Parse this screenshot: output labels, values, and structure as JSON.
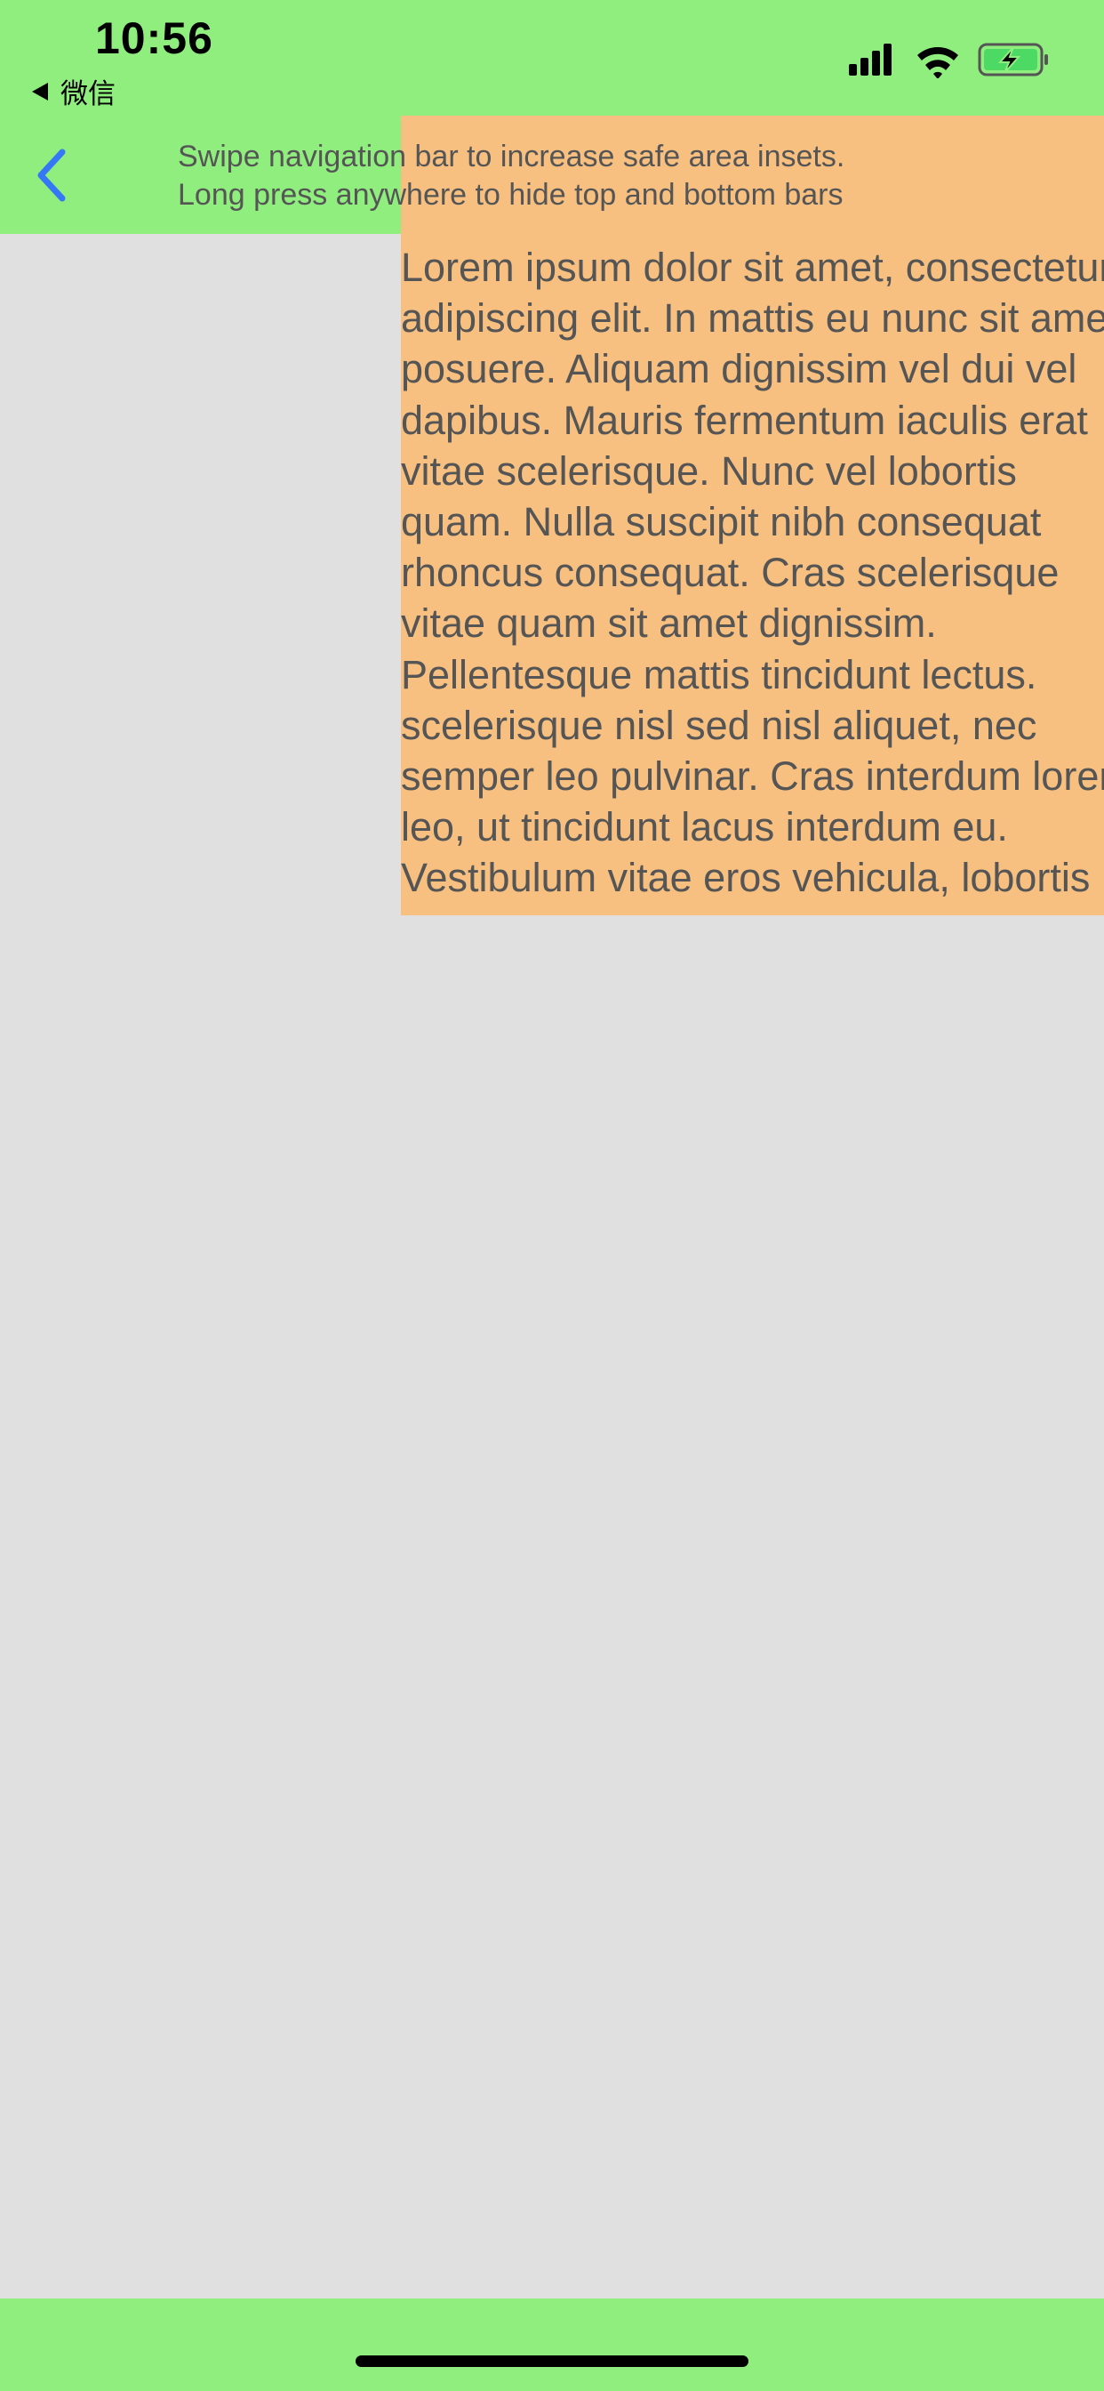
{
  "status_bar": {
    "time": "10:56",
    "back_app_label": "微信",
    "back_app_icon": "back-triangle-icon",
    "signal_icon": "cellular-signal-icon",
    "wifi_icon": "wifi-icon",
    "battery_icon": "battery-charging-icon"
  },
  "nav_bar": {
    "back_icon": "chevron-left-icon",
    "hint_line1": "Swipe navigation bar to increase safe area insets.",
    "hint_line2": "Long press anywhere to hide top and bottom bars"
  },
  "content": {
    "lines": [
      "Lorem ipsum dolor sit amet, consectetur",
      "adipiscing elit. In mattis eu nunc sit amet",
      "posuere. Aliquam dignissim vel dui vel",
      "dapibus. Mauris fermentum iaculis erat",
      "vitae scelerisque. Nunc vel lobortis",
      "quam. Nulla suscipit nibh consequat",
      "rhoncus consequat. Cras scelerisque",
      "vitae quam sit amet dignissim.",
      "Pellentesque mattis tincidunt lectus.",
      "scelerisque nisl sed nisl aliquet, nec",
      "semper leo pulvinar. Cras interdum lorem",
      "leo, ut tincidunt lacus interdum eu.",
      "Vestibulum vitae eros vehicula, lobortis"
    ]
  },
  "colors": {
    "bar_background": "#90ee7e",
    "content_background": "#f7c080",
    "page_background": "#e0e0e0",
    "accent_blue": "#3478f6",
    "text_gray": "#555555"
  }
}
